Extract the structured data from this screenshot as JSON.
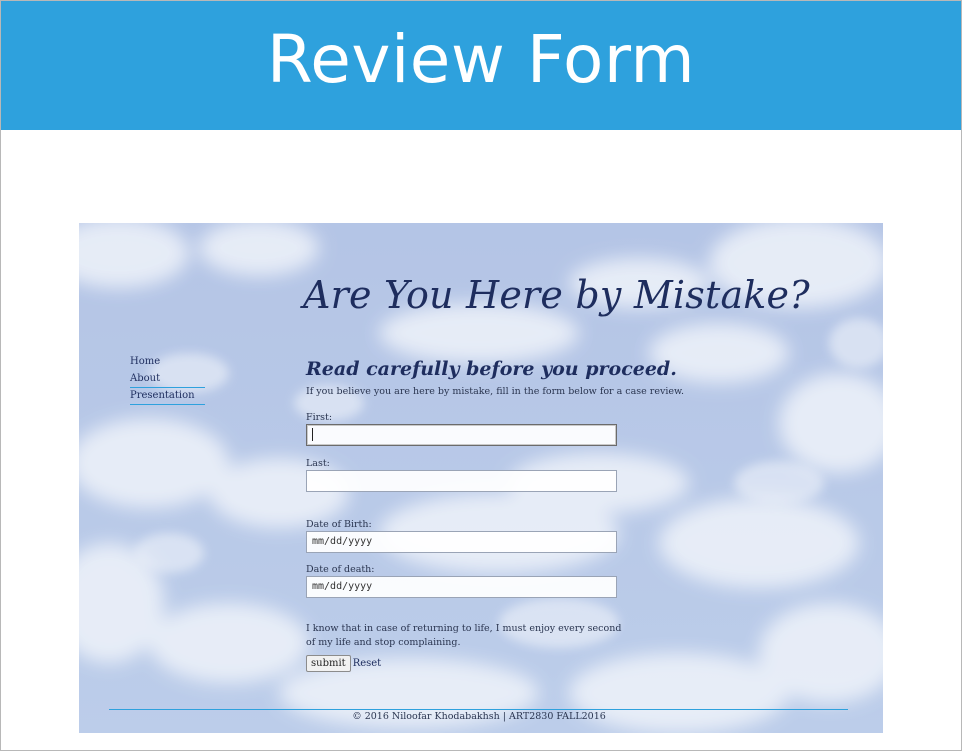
{
  "slide": {
    "title": "Review Form",
    "header_color": "#2ea1dd"
  },
  "site": {
    "heading": "Are You Here by Mistake?",
    "nav": [
      {
        "label": "Home"
      },
      {
        "label": "About"
      },
      {
        "label": "Presentation"
      }
    ],
    "subheading": "Read carefully before you proceed.",
    "intro": "If you believe you are here by mistake, fill in the form below for a case review.",
    "form": {
      "first_label": "First:",
      "first_value": "",
      "last_label": "Last:",
      "last_value": "",
      "dob_label": "Date of Birth:",
      "dob_value": "mm/dd/yyyy",
      "dod_label": "Date of death:",
      "dod_value": "mm/dd/yyyy",
      "agreement": "I know that in case of returning to life, I must enjoy every second of my life and stop complaining.",
      "submit_label": "submit",
      "reset_label": "Reset"
    },
    "footer": "© 2016 Niloofar Khodabakhsh | ART2830 FALL2016",
    "colors": {
      "heading": "#1e2d5e",
      "accent": "#2ea1dd",
      "sky": "#b4c6e6"
    }
  }
}
